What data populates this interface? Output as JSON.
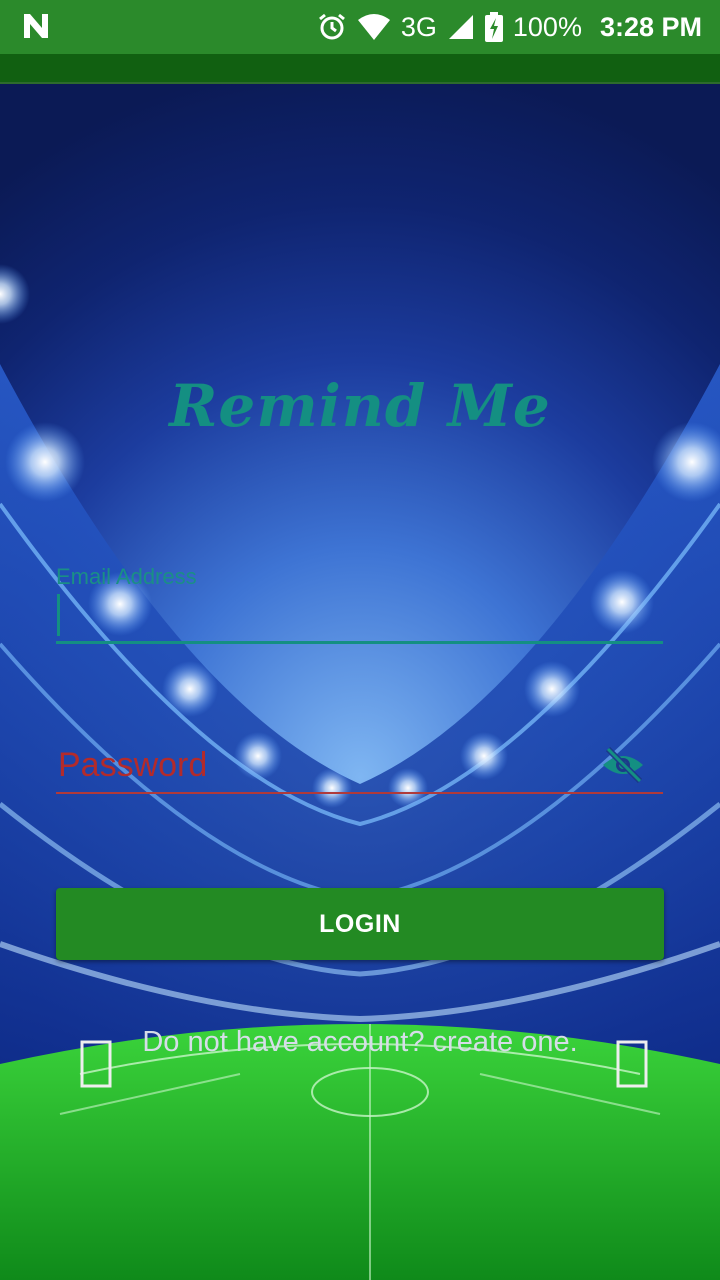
{
  "status_bar": {
    "network": "3G",
    "battery": "100%",
    "time": "3:28 PM",
    "icons": [
      "n-notification-icon",
      "alarm-icon",
      "wifi-icon",
      "signal-icon",
      "battery-charging-icon"
    ]
  },
  "app": {
    "title": "Remind Me"
  },
  "form": {
    "email_label": "Email Address",
    "email_value": "",
    "password_placeholder": "Password",
    "password_value": "",
    "login_label": "LOGIN",
    "signup_link": "Do not have account? create one."
  },
  "colors": {
    "status_bar": "#2b8a2b",
    "accent_teal": "#148f82",
    "error_red": "#b32b2b",
    "button_green": "#238a23"
  }
}
